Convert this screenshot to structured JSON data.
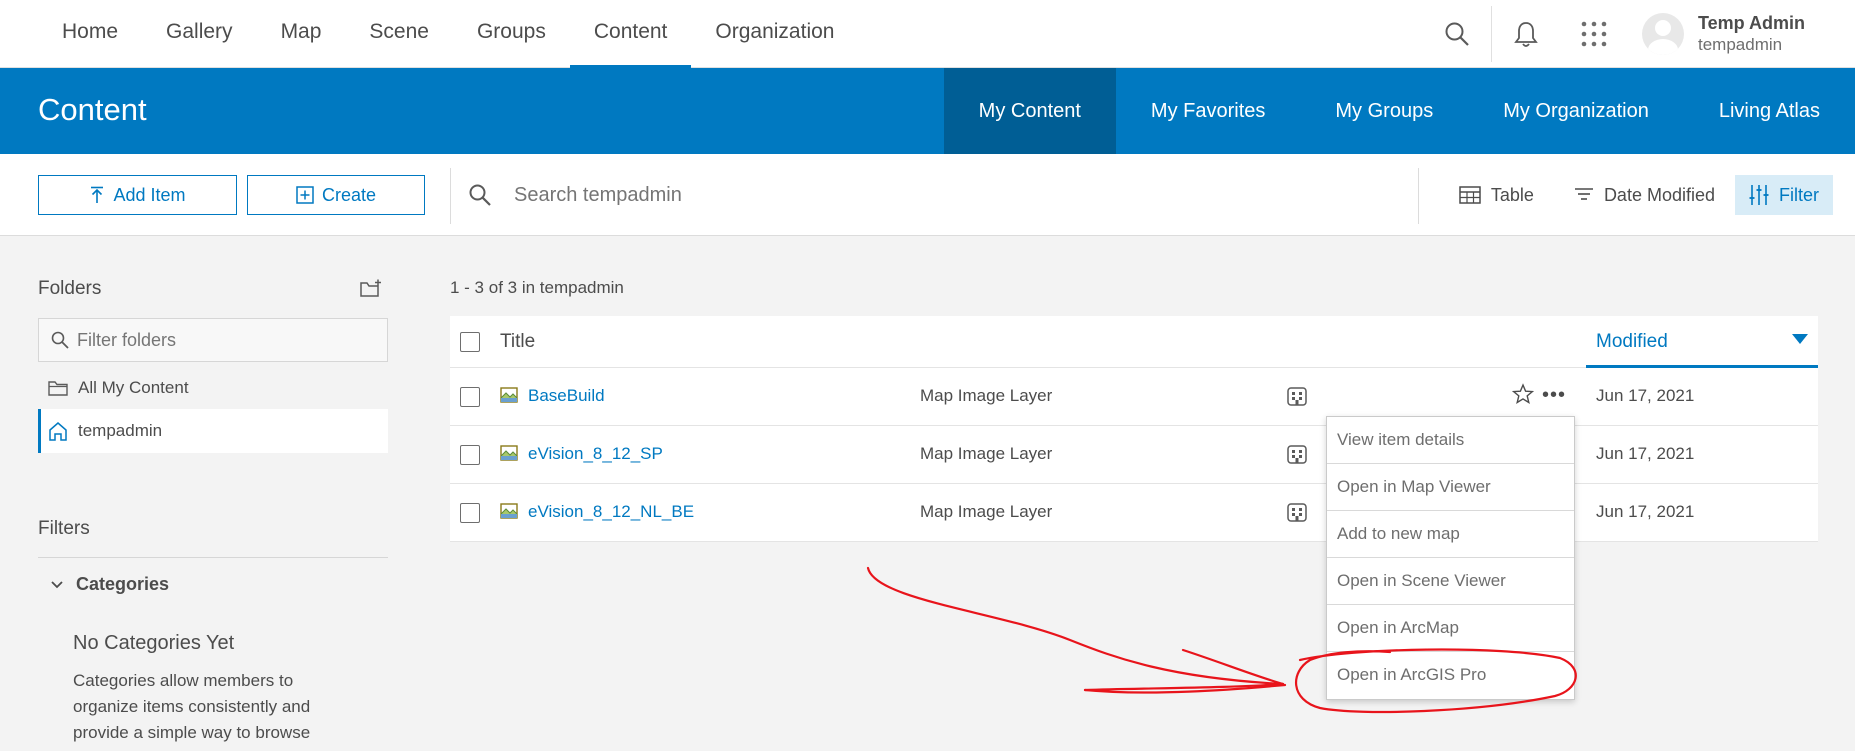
{
  "topnav": {
    "links": [
      "Home",
      "Gallery",
      "Map",
      "Scene",
      "Groups",
      "Content",
      "Organization"
    ],
    "active": "Content",
    "user": {
      "name": "Temp Admin",
      "username": "tempadmin"
    }
  },
  "header": {
    "title": "Content",
    "tabs": [
      "My Content",
      "My Favorites",
      "My Groups",
      "My Organization",
      "Living Atlas"
    ],
    "active_tab": "My Content"
  },
  "toolbar": {
    "add_item": "Add Item",
    "create": "Create",
    "search_placeholder": "Search tempadmin",
    "view": "Table",
    "sort": "Date Modified",
    "filter": "Filter"
  },
  "sidebar": {
    "folders_title": "Folders",
    "filter_placeholder": "Filter folders",
    "folders": [
      "All My Content",
      "tempadmin"
    ],
    "filters_title": "Filters",
    "categories_label": "Categories",
    "no_categories": "No Categories Yet",
    "categories_desc": "Categories allow members to organize items consistently and provide a simple way to browse"
  },
  "list": {
    "count": "1 - 3 of 3 in tempadmin",
    "col_title": "Title",
    "col_modified": "Modified",
    "rows": [
      {
        "name": "BaseBuild",
        "type": "Map Image Layer",
        "modified": "Jun 17, 2021"
      },
      {
        "name": "eVision_8_12_SP",
        "type": "Map Image Layer",
        "modified": "Jun 17, 2021"
      },
      {
        "name": "eVision_8_12_NL_BE",
        "type": "Map Image Layer",
        "modified": "Jun 17, 2021"
      }
    ]
  },
  "menu": {
    "items": [
      "View item details",
      "Open in Map Viewer",
      "Add to new map",
      "Open in Scene Viewer",
      "Open in ArcMap",
      "Open in ArcGIS Pro"
    ]
  },
  "colors": {
    "accent": "#0079c1",
    "band_active": "#005e95",
    "annotation": "#e8141b"
  }
}
